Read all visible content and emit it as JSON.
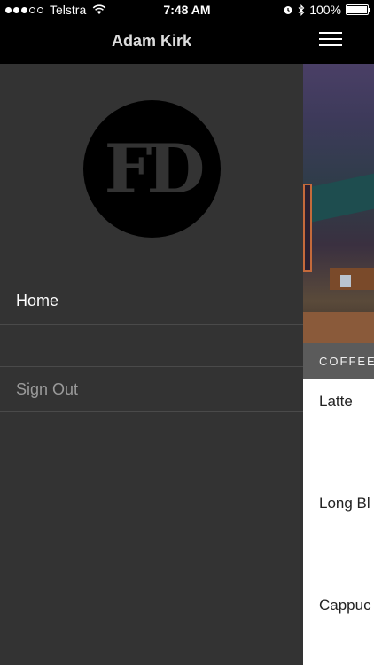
{
  "status_bar": {
    "carrier": "Telstra",
    "time": "7:48 AM",
    "battery": "100%",
    "battery_level": 1.0,
    "signal_bars_filled": 3,
    "signal_bars_total": 5
  },
  "drawer": {
    "user_name": "Adam Kirk",
    "logo_text": "FD",
    "menu": [
      {
        "label": "Home"
      },
      {
        "label": ""
      },
      {
        "label": "Sign Out"
      }
    ]
  },
  "main": {
    "section_label": "COFFEE",
    "items": [
      "Latte",
      "Long Bl",
      "Cappuc"
    ]
  },
  "colors": {
    "drawer_bg": "#333333",
    "header_bg": "#000000",
    "section_bar_bg": "#5b5b5b"
  }
}
